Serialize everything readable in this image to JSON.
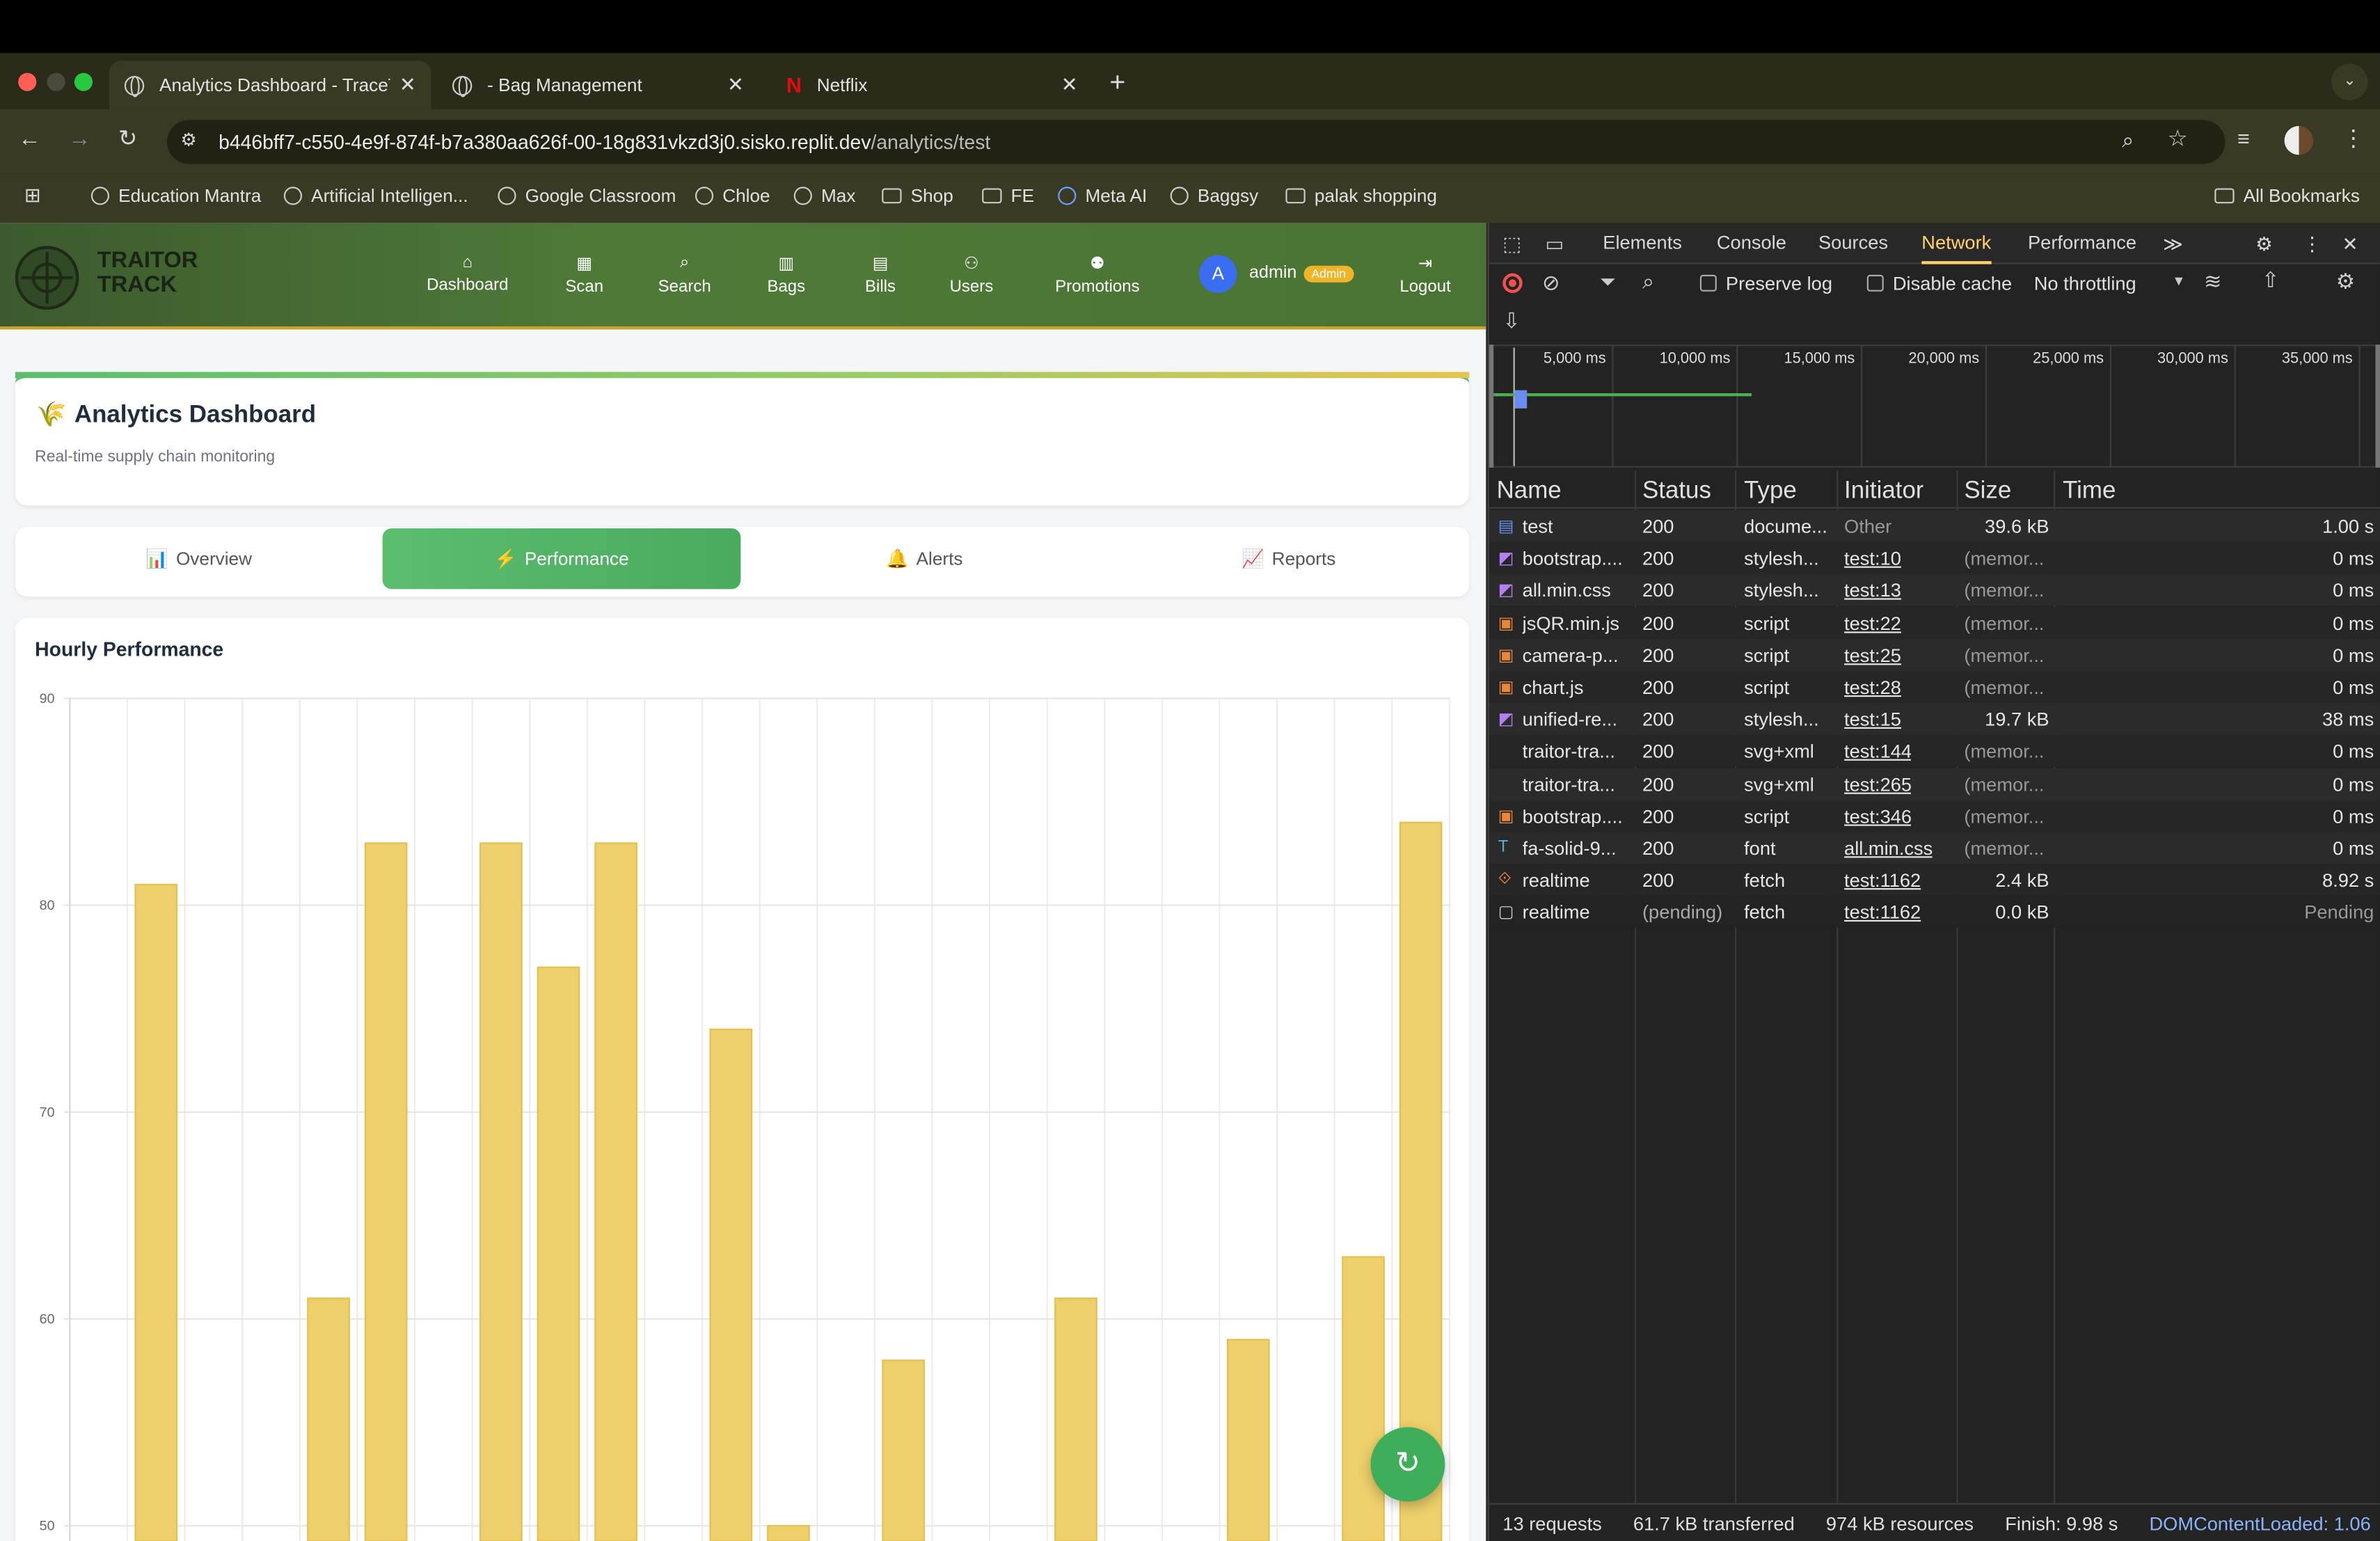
{
  "browser": {
    "tabs": [
      {
        "title": "Analytics Dashboard - TraceT",
        "active": true
      },
      {
        "title": "- Bag Management",
        "active": false
      },
      {
        "title": "Netflix",
        "active": false
      }
    ],
    "new_tab_label": "+",
    "url_host": "b446bff7-c550-4e9f-874f-b7a380aa626f-00-18g831vkzd3j0.sisko.replit.dev",
    "url_path": "/analytics/test",
    "bookmarks": [
      "Education Mantra",
      "Artificial Intelligen...",
      "Google Classroom",
      "Chloe",
      "Max",
      "Shop",
      "FE",
      "Meta AI",
      "Baggsy",
      "palak shopping"
    ],
    "all_bookmarks": "All Bookmarks"
  },
  "app": {
    "brand_line1": "TRAITOR",
    "brand_line2": "TRACK",
    "nav": [
      "Dashboard",
      "Scan",
      "Search",
      "Bags",
      "Bills",
      "Users",
      "Promotions"
    ],
    "user_initial": "A",
    "user_name": "admin",
    "user_badge": "Admin",
    "logout": "Logout",
    "header_title": "Analytics Dashboard",
    "header_subtitle": "Real-time supply chain monitoring",
    "tabs": [
      {
        "label": "Overview",
        "icon": "📊",
        "active": false
      },
      {
        "label": "Performance",
        "icon": "⚡",
        "active": true
      },
      {
        "label": "Alerts",
        "icon": "🔔",
        "active": false
      },
      {
        "label": "Reports",
        "icon": "📈",
        "active": false
      }
    ],
    "chart_title": "Hourly Performance",
    "accent": "#5cbd6f",
    "bar_color": "#edcf6b"
  },
  "chart_data": {
    "type": "bar",
    "title": "Hourly Performance",
    "y_ticks": [
      "90",
      "80",
      "70",
      "60",
      "50"
    ],
    "ylim": [
      50,
      90
    ],
    "grid": true,
    "values": [
      null,
      81,
      null,
      null,
      61,
      83,
      null,
      83,
      77,
      83,
      null,
      74,
      50,
      null,
      58,
      null,
      null,
      61,
      null,
      null,
      59,
      null,
      63,
      84
    ]
  },
  "devtools": {
    "tabs": [
      "Elements",
      "Console",
      "Sources",
      "Network",
      "Performance"
    ],
    "active_tab": "Network",
    "preserve_log": "Preserve log",
    "disable_cache": "Disable cache",
    "throttling": "No throttling",
    "timeline_ticks": [
      "5,000 ms",
      "10,000 ms",
      "15,000 ms",
      "20,000 ms",
      "25,000 ms",
      "30,000 ms",
      "35,000 ms"
    ],
    "columns": [
      "Name",
      "Status",
      "Type",
      "Initiator",
      "Size",
      "Time"
    ],
    "rows": [
      {
        "icon": "doc",
        "name": "test",
        "status": "200",
        "type": "docume...",
        "initiator": "Other",
        "size": "39.6 kB",
        "time": "1.00 s"
      },
      {
        "icon": "css",
        "name": "bootstrap....",
        "status": "200",
        "type": "stylesh...",
        "initiator": "test:10",
        "size": "(memor...",
        "time": "0 ms"
      },
      {
        "icon": "css",
        "name": "all.min.css",
        "status": "200",
        "type": "stylesh...",
        "initiator": "test:13",
        "size": "(memor...",
        "time": "0 ms"
      },
      {
        "icon": "js",
        "name": "jsQR.min.js",
        "status": "200",
        "type": "script",
        "initiator": "test:22",
        "size": "(memor...",
        "time": "0 ms"
      },
      {
        "icon": "js",
        "name": "camera-p...",
        "status": "200",
        "type": "script",
        "initiator": "test:25",
        "size": "(memor...",
        "time": "0 ms"
      },
      {
        "icon": "js",
        "name": "chart.js",
        "status": "200",
        "type": "script",
        "initiator": "test:28",
        "size": "(memor...",
        "time": "0 ms"
      },
      {
        "icon": "css",
        "name": "unified-re...",
        "status": "200",
        "type": "stylesh...",
        "initiator": "test:15",
        "size": "19.7 kB",
        "time": "38 ms"
      },
      {
        "icon": "none",
        "name": "traitor-tra...",
        "status": "200",
        "type": "svg+xml",
        "initiator": "test:144",
        "size": "(memor...",
        "time": "0 ms"
      },
      {
        "icon": "none",
        "name": "traitor-tra...",
        "status": "200",
        "type": "svg+xml",
        "initiator": "test:265",
        "size": "(memor...",
        "time": "0 ms"
      },
      {
        "icon": "js",
        "name": "bootstrap....",
        "status": "200",
        "type": "script",
        "initiator": "test:346",
        "size": "(memor...",
        "time": "0 ms"
      },
      {
        "icon": "font",
        "name": "fa-solid-9...",
        "status": "200",
        "type": "font",
        "initiator": "all.min.css",
        "size": "(memor...",
        "time": "0 ms"
      },
      {
        "icon": "fetch",
        "name": "realtime",
        "status": "200",
        "type": "fetch",
        "initiator": "test:1162",
        "size": "2.4 kB",
        "time": "8.92 s"
      },
      {
        "icon": "blank",
        "name": "realtime",
        "status": "(pending)",
        "type": "fetch",
        "initiator": "test:1162",
        "size": "0.0 kB",
        "time": "Pending"
      }
    ],
    "status_bar": [
      "13 requests",
      "61.7 kB transferred",
      "974 kB resources",
      "Finish: 9.98 s",
      "DOMContentLoaded: 1.06"
    ]
  }
}
